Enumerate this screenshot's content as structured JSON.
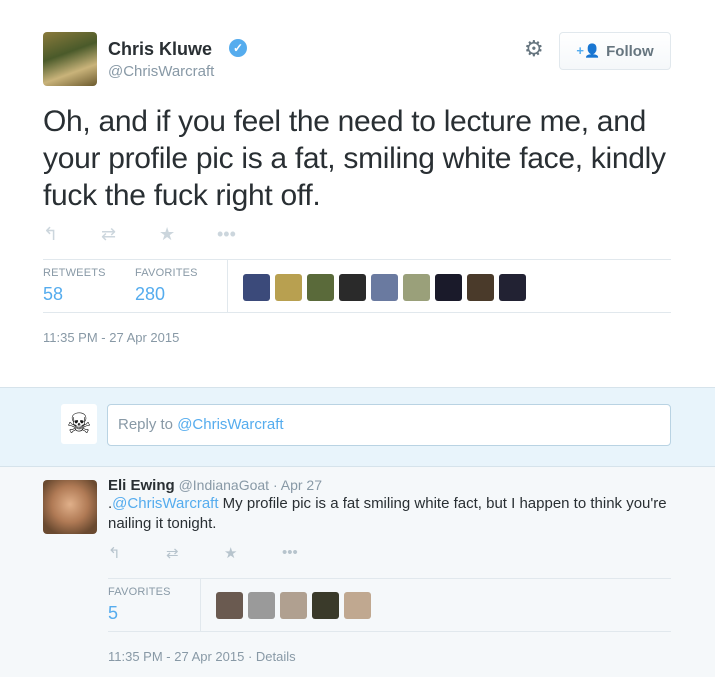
{
  "tweet": {
    "author_name": "Chris Kluwe",
    "author_handle": "@ChrisWarcraft",
    "verified_glyph": "✓",
    "follow_label": "Follow",
    "text": "Oh, and if you feel the need to lecture me, and your profile pic is a fat, smiling white face, kindly fuck the fuck right off.",
    "actions": [
      "reply-icon",
      "retweet-icon",
      "favorite-icon",
      "more-icon"
    ],
    "stats": {
      "retweets_label": "RETWEETS",
      "retweets_value": "58",
      "favorites_label": "FAVORITES",
      "favorites_value": "280"
    },
    "favoriter_colors": [
      "#3b4a7a",
      "#b8a050",
      "#5a6a3a",
      "#2a2a2a",
      "#6a7aa0",
      "#9aa07a",
      "#1a1a2a",
      "#4a3a2a",
      "#223"
    ],
    "timestamp": "11:35 PM - 27 Apr 2015"
  },
  "reply_box": {
    "placeholder_prefix": "Reply to ",
    "placeholder_mention": "@ChrisWarcraft"
  },
  "reply": {
    "name": "Eli Ewing",
    "handle": "@IndianaGoat",
    "sep": " · ",
    "date": "Apr 27",
    "text_prefix": ".",
    "mention": "@ChrisWarcraft",
    "text_body": " My profile pic is a fat smiling white fact, but I happen to think you're nailing it tonight.",
    "favorites_label": "FAVORITES",
    "favorites_value": "5",
    "favoriter_colors": [
      "#6a5a50",
      "#9a9a9a",
      "#b0a090",
      "#3a3a2a",
      "#c0a890"
    ],
    "timestamp": "11:35 PM - 27 Apr 2015",
    "details_label": "Details"
  }
}
